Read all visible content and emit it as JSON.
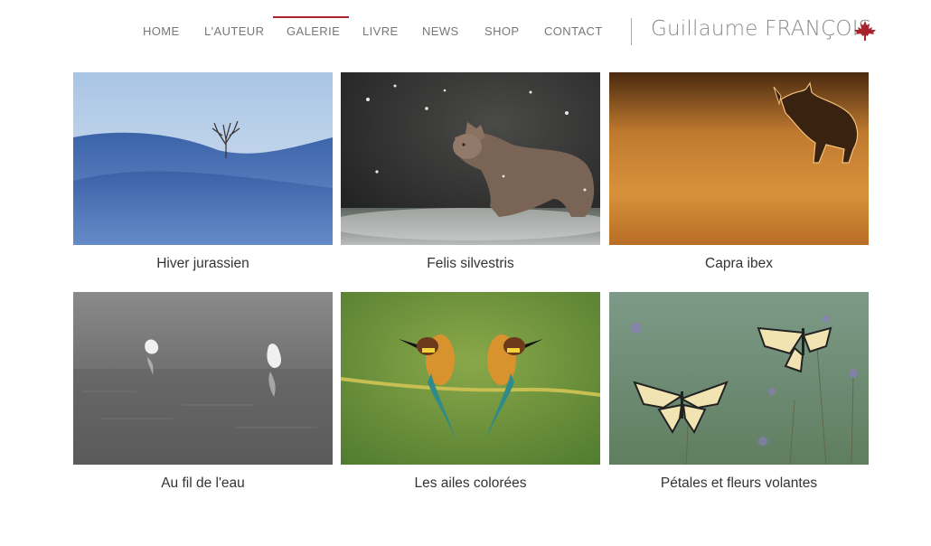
{
  "nav": {
    "items": [
      {
        "label": "HOME",
        "active": false
      },
      {
        "label": "L'AUTEUR",
        "active": false
      },
      {
        "label": "GALERIE",
        "active": true
      },
      {
        "label": "LIVRE",
        "active": false
      },
      {
        "label": "NEWS",
        "active": false
      },
      {
        "label": "SHOP",
        "active": false
      },
      {
        "label": "CONTACT",
        "active": false
      }
    ],
    "active_color": "#a8232d"
  },
  "brand": {
    "name": "Guillaume FRANÇOIS",
    "logo_icon": "maple-leaf-icon",
    "logo_color": "#a8232d"
  },
  "gallery": {
    "items": [
      {
        "caption": "Hiver jurassien",
        "image": "snowy-hills-lone-tree"
      },
      {
        "caption": "Felis silvestris",
        "image": "wildcat-in-snow"
      },
      {
        "caption": "Capra ibex",
        "image": "ibex-silhouette-golden-backlight"
      },
      {
        "caption": "Au fil de l'eau",
        "image": "egrets-in-misty-water"
      },
      {
        "caption": "Les ailes colorées",
        "image": "bee-eaters-on-branch"
      },
      {
        "caption": "Pétales et fleurs volantes",
        "image": "swallowtail-butterflies-on-flowers"
      }
    ]
  }
}
